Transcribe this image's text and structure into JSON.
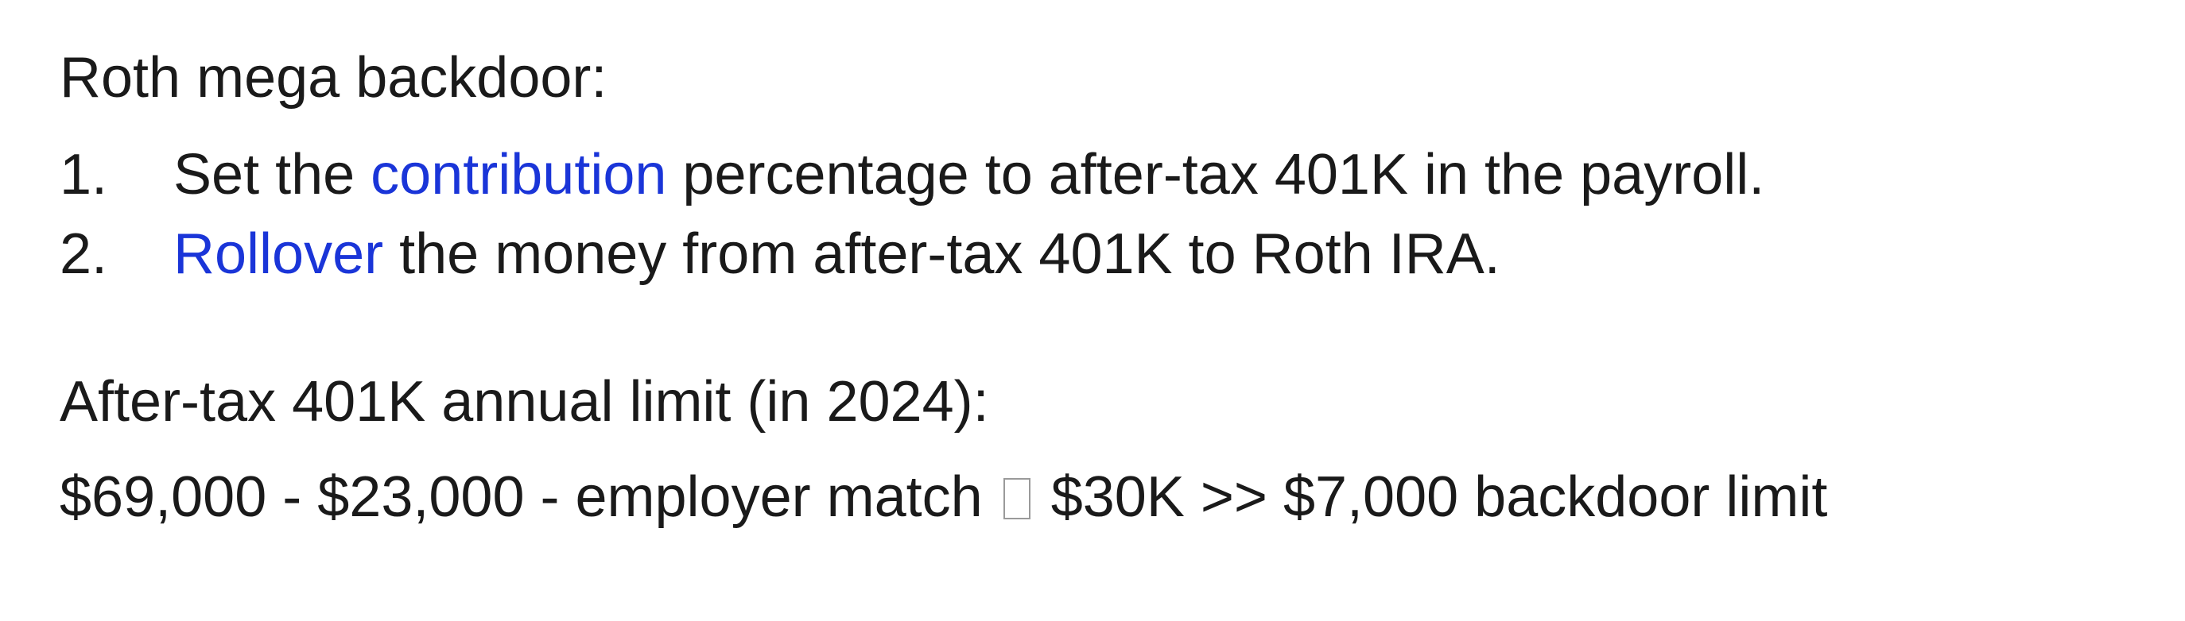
{
  "heading": "Roth mega backdoor:",
  "steps": [
    {
      "number": "1.",
      "before": "Set the ",
      "link": "contribution",
      "after": " percentage to after-tax 401K in the payroll."
    },
    {
      "number": "2.",
      "before": "",
      "link": "Rollover",
      "after": " the money from after-tax 401K to Roth IRA."
    }
  ],
  "limit_heading": "After-tax 401K annual limit (in 2024):",
  "formula": {
    "left": "$69,000 - $23,000 -  employer match ",
    "right": " $30K >> $7,000 backdoor limit"
  },
  "colors": {
    "link": "#1a35d8",
    "text": "#1a1a1a"
  }
}
